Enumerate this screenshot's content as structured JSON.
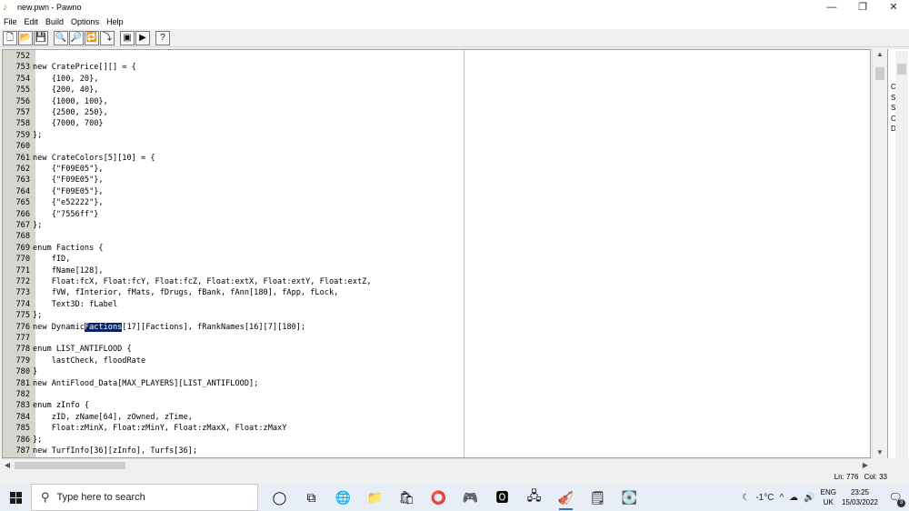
{
  "window": {
    "title": "new.pwn - Pawno",
    "minimize_glyph": "—",
    "restore_glyph": "❐",
    "close_glyph": "✕"
  },
  "menu": [
    "File",
    "Edit",
    "Build",
    "Options",
    "Help"
  ],
  "toolbar": {
    "buttons": [
      {
        "name": "new-file-icon",
        "glyph": "🗋"
      },
      {
        "name": "open-file-icon",
        "glyph": "📂"
      },
      {
        "name": "save-file-icon",
        "glyph": "💾"
      },
      {
        "name": "find-icon",
        "glyph": "🔍"
      },
      {
        "name": "find-next-icon",
        "glyph": "🔎"
      },
      {
        "name": "replace-icon",
        "glyph": "🔁"
      },
      {
        "name": "goto-line-icon",
        "glyph": "⤵"
      },
      {
        "name": "compile-icon",
        "glyph": "▣"
      },
      {
        "name": "run-icon",
        "glyph": "▶"
      },
      {
        "name": "help-icon",
        "glyph": "?"
      }
    ]
  },
  "editor": {
    "lines": [
      {
        "n": "752",
        "t": ""
      },
      {
        "n": "753",
        "t": "new CratePrice[][] = {"
      },
      {
        "n": "754",
        "t": "    {100, 20},"
      },
      {
        "n": "755",
        "t": "    {200, 40},"
      },
      {
        "n": "756",
        "t": "    {1000, 100},"
      },
      {
        "n": "757",
        "t": "    {2500, 250},"
      },
      {
        "n": "758",
        "t": "    {7000, 700}"
      },
      {
        "n": "759",
        "t": "};"
      },
      {
        "n": "760",
        "t": ""
      },
      {
        "n": "761",
        "t": "new CrateColors[5][10] = {"
      },
      {
        "n": "762",
        "t": "    {\"F09E05\"},"
      },
      {
        "n": "763",
        "t": "    {\"F09E05\"},"
      },
      {
        "n": "764",
        "t": "    {\"F09E05\"},"
      },
      {
        "n": "765",
        "t": "    {\"e52222\"},"
      },
      {
        "n": "766",
        "t": "    {\"7556ff\"}"
      },
      {
        "n": "767",
        "t": "};"
      },
      {
        "n": "768",
        "t": ""
      },
      {
        "n": "769",
        "t": "enum Factions {"
      },
      {
        "n": "770",
        "t": "    fID,"
      },
      {
        "n": "771",
        "t": "    fName[128],"
      },
      {
        "n": "772",
        "t": "    Float:fcX, Float:fcY, Float:fcZ, Float:extX, Float:extY, Float:extZ,"
      },
      {
        "n": "773",
        "t": "    fVW, fInterior, fMats, fDrugs, fBank, fAnn[180], fApp, fLock,"
      },
      {
        "n": "774",
        "t": "    Text3D: fLabel"
      },
      {
        "n": "775",
        "t": "};"
      },
      {
        "n": "776",
        "t": "new DynamicFactions[17][Factions], fRankNames[16][7][180];"
      },
      {
        "n": "777",
        "t": ""
      },
      {
        "n": "778",
        "t": "enum LIST_ANTIFLOOD {"
      },
      {
        "n": "779",
        "t": "    lastCheck, floodRate"
      },
      {
        "n": "780",
        "t": "}"
      },
      {
        "n": "781",
        "t": "new AntiFlood_Data[MAX_PLAYERS][LIST_ANTIFLOOD];"
      },
      {
        "n": "782",
        "t": ""
      },
      {
        "n": "783",
        "t": "enum zInfo {"
      },
      {
        "n": "784",
        "t": "    zID, zName[64], zOwned, zTime,"
      },
      {
        "n": "785",
        "t": "    Float:zMinX, Float:zMinY, Float:zMaxX, Float:zMaxY"
      },
      {
        "n": "786",
        "t": "};"
      },
      {
        "n": "787",
        "t": "new TurfInfo[36][zInfo], Turfs[36];"
      }
    ],
    "selection": "Factions",
    "selection_line": "776"
  },
  "right_panel": {
    "items": [
      "C",
      "S",
      "S",
      "C",
      "D"
    ]
  },
  "status": {
    "line": "Ln: 776",
    "col": "Col: 33"
  },
  "taskbar": {
    "search_placeholder": "Type here to search",
    "apps": [
      {
        "name": "cortana-icon",
        "glyph": "◯",
        "active": false
      },
      {
        "name": "task-view-icon",
        "glyph": "⧉",
        "active": false
      },
      {
        "name": "edge-icon",
        "glyph": "🌐",
        "active": false
      },
      {
        "name": "file-explorer-icon",
        "glyph": "📁",
        "active": false
      },
      {
        "name": "store-icon",
        "glyph": "🛍",
        "active": false
      },
      {
        "name": "opera-gx-icon",
        "glyph": "⭕",
        "active": false
      },
      {
        "name": "game-app-icon",
        "glyph": "🎮",
        "active": false
      },
      {
        "name": "opera-icon",
        "glyph": "🅾",
        "active": false
      },
      {
        "name": "network-tool-icon",
        "glyph": "🖧",
        "active": false
      },
      {
        "name": "pawno-icon",
        "glyph": "🎻",
        "active": true
      },
      {
        "name": "notepad-icon",
        "glyph": "🗒",
        "active": false
      },
      {
        "name": "disk-tool-icon",
        "glyph": "💽",
        "active": false
      }
    ],
    "weather": "-1°C",
    "lang_top": "ENG",
    "lang_bottom": "UK",
    "time": "23:25",
    "date": "15/03/2022",
    "notification_count": "3"
  }
}
